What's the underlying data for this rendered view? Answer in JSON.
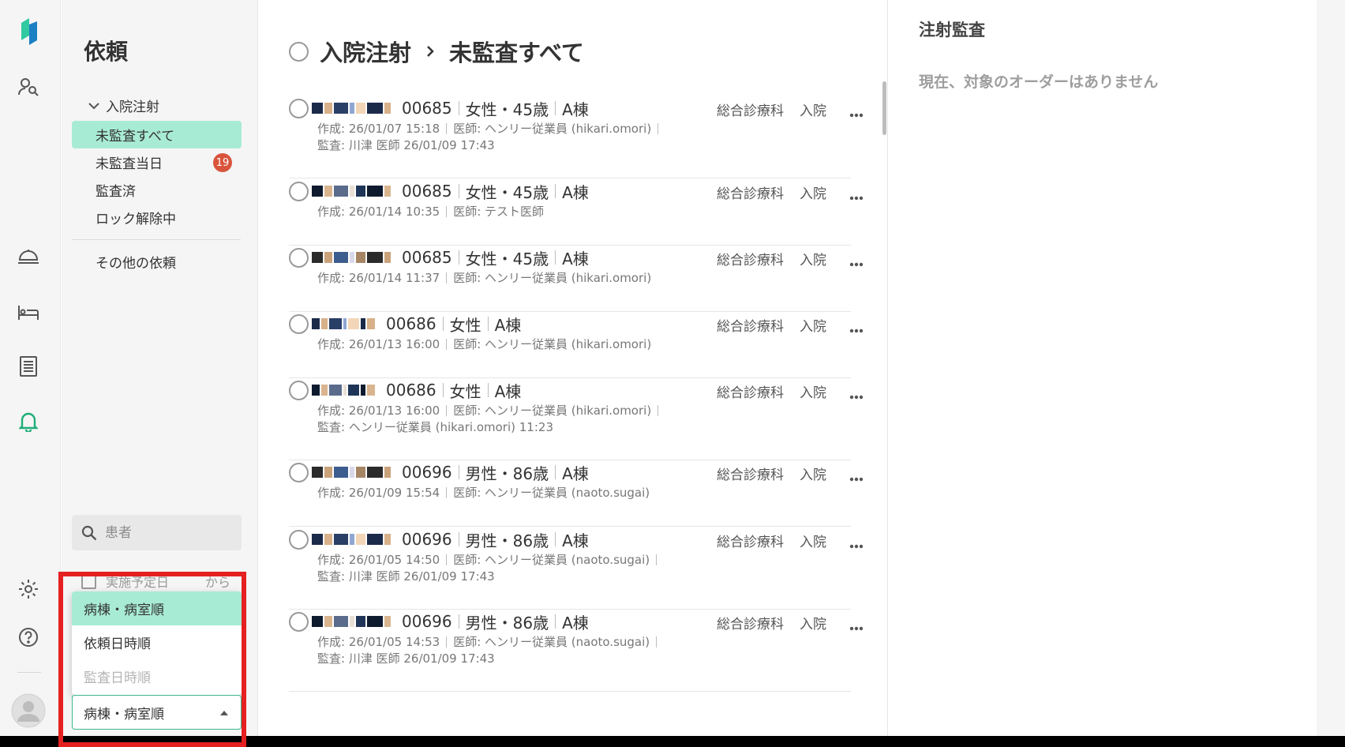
{
  "sidebar": {
    "title": "依頼",
    "group": "入院注射",
    "items": [
      {
        "label": "未監査すべて",
        "active": true
      },
      {
        "label": "未監査当日",
        "badge": "19"
      },
      {
        "label": "監査済"
      },
      {
        "label": "ロック解除中"
      }
    ],
    "other": "その他の依頼",
    "search_placeholder": "患者",
    "date_filter": {
      "label": "実施予定日",
      "suffix": "から"
    },
    "sort_options": [
      "病棟・病室順",
      "依頼日時順",
      "監査日時順"
    ],
    "sort_selected": "病棟・病室順"
  },
  "main": {
    "breadcrumb": [
      "入院注射",
      "未監査すべて"
    ],
    "orders": [
      {
        "id": "00685",
        "sex": "女性・45歳",
        "ward": "A棟",
        "dept": "総合診療科",
        "kind": "入院",
        "created": "作成: 26/01/07 15:18",
        "doctor": "医師: ヘンリー従業員 (hikari.omori)",
        "audit": "監査: 川津 医師 26/01/09 17:43"
      },
      {
        "id": "00685",
        "sex": "女性・45歳",
        "ward": "A棟",
        "dept": "総合診療科",
        "kind": "入院",
        "created": "作成: 26/01/14 10:35",
        "doctor": "医師: テスト医師",
        "audit": ""
      },
      {
        "id": "00685",
        "sex": "女性・45歳",
        "ward": "A棟",
        "dept": "総合診療科",
        "kind": "入院",
        "created": "作成: 26/01/14 11:37",
        "doctor": "医師: ヘンリー従業員 (hikari.omori)",
        "audit": ""
      },
      {
        "id": "00686",
        "sex": "女性",
        "ward": "A棟",
        "dept": "総合診療科",
        "kind": "入院",
        "created": "作成: 26/01/13 16:00",
        "doctor": "医師: ヘンリー従業員 (hikari.omori)",
        "audit": ""
      },
      {
        "id": "00686",
        "sex": "女性",
        "ward": "A棟",
        "dept": "総合診療科",
        "kind": "入院",
        "created": "作成: 26/01/13 16:00",
        "doctor": "医師: ヘンリー従業員 (hikari.omori)",
        "audit": "監査: ヘンリー従業員 (hikari.omori) 11:23"
      },
      {
        "id": "00696",
        "sex": "男性・86歳",
        "ward": "A棟",
        "dept": "総合診療科",
        "kind": "入院",
        "created": "作成: 26/01/09 15:54",
        "doctor": "医師: ヘンリー従業員 (naoto.sugai)",
        "audit": ""
      },
      {
        "id": "00696",
        "sex": "男性・86歳",
        "ward": "A棟",
        "dept": "総合診療科",
        "kind": "入院",
        "created": "作成: 26/01/05 14:50",
        "doctor": "医師: ヘンリー従業員 (naoto.sugai)",
        "audit": "監査: 川津 医師 26/01/09 17:43"
      },
      {
        "id": "00696",
        "sex": "男性・86歳",
        "ward": "A棟",
        "dept": "総合診療科",
        "kind": "入院",
        "created": "作成: 26/01/05 14:53",
        "doctor": "医師: ヘンリー従業員 (naoto.sugai)",
        "audit": "監査: 川津 医師 26/01/09 17:43"
      }
    ]
  },
  "right": {
    "title": "注射監査",
    "empty_message": "現在、対象のオーダーはありません"
  },
  "colors": {
    "accent": "#a8ebd4",
    "badge": "#d9543c",
    "active_icon": "#1fae7a",
    "highlight": "#e52020"
  }
}
